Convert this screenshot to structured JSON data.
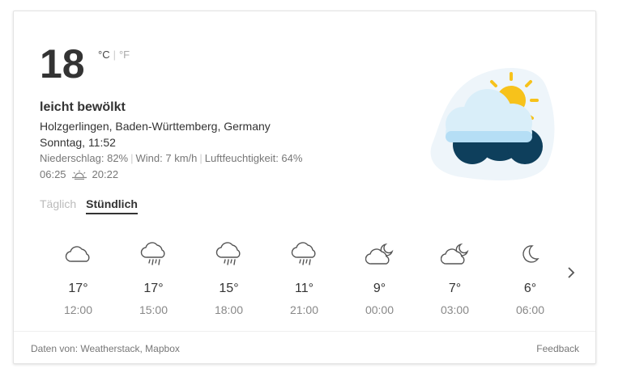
{
  "current": {
    "temperature": "18",
    "unit_c": "°C",
    "unit_separator": "|",
    "unit_f": "°F",
    "condition": "leicht bewölkt",
    "location": "Holzgerlingen, Baden-Württemberg, Germany",
    "datetime": "Sonntag, 11:52",
    "precipitation": "Niederschlag: 82%",
    "wind": "Wind: 7 km/h",
    "humidity": "Luftfeuchtigkeit: 64%",
    "sunrise": "06:25",
    "sunset": "20:22",
    "icon": "partly-cloudy-sun-icon"
  },
  "tabs": {
    "daily": "Täglich",
    "hourly": "Stündlich",
    "active": "hourly"
  },
  "forecast": [
    {
      "temp": "17°",
      "time": "12:00",
      "icon": "cloud-icon"
    },
    {
      "temp": "17°",
      "time": "15:00",
      "icon": "rain-cloud-icon"
    },
    {
      "temp": "15°",
      "time": "18:00",
      "icon": "rain-cloud-icon"
    },
    {
      "temp": "11°",
      "time": "21:00",
      "icon": "rain-cloud-icon"
    },
    {
      "temp": "9°",
      "time": "00:00",
      "icon": "cloud-moon-icon"
    },
    {
      "temp": "7°",
      "time": "03:00",
      "icon": "cloud-moon-icon"
    },
    {
      "temp": "6°",
      "time": "06:00",
      "icon": "moon-icon"
    }
  ],
  "footer": {
    "source": "Daten von: Weatherstack, Mapbox",
    "feedback": "Feedback"
  },
  "colors": {
    "sun": "#f7c21b",
    "cloud_light": "#d7eefa",
    "cloud_dark": "#0e3f5c",
    "icon_stroke": "#555555"
  }
}
